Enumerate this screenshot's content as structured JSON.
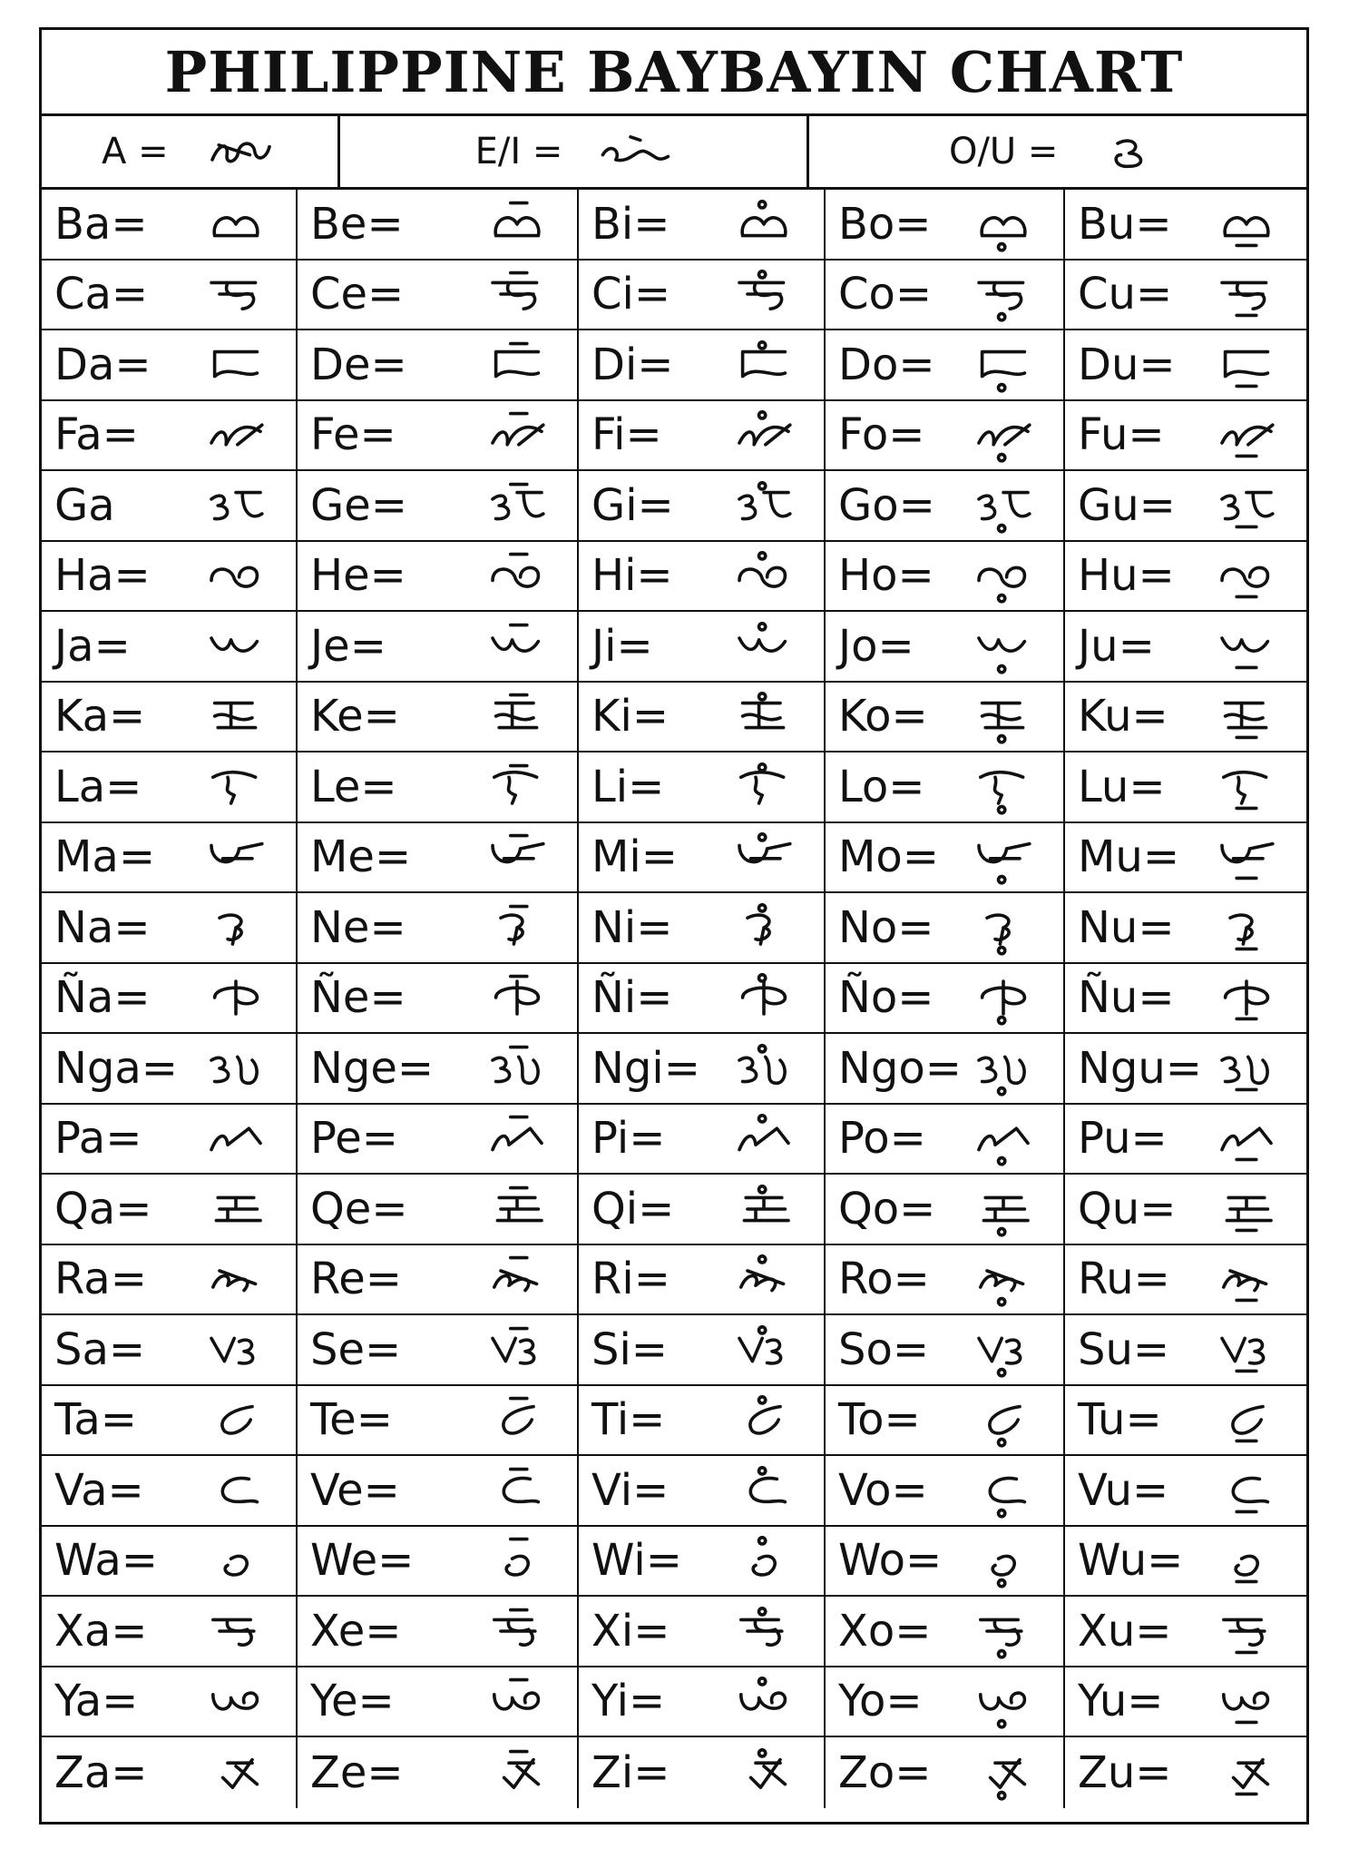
{
  "title": "PHILIPPINE BAYBAYIN CHART",
  "vowels": [
    {
      "label": "A =",
      "glyph": "a",
      "icon": "baybayin-a-icon"
    },
    {
      "label": "E/I =",
      "glyph": "ei",
      "icon": "baybayin-ei-icon"
    },
    {
      "label": "O/U =",
      "glyph": "ou",
      "icon": "baybayin-ou-icon"
    }
  ],
  "rows": [
    {
      "cells": [
        "Ba=",
        "Be=",
        "Bi=",
        "Bo=",
        "Bu="
      ]
    },
    {
      "cells": [
        "Ca=",
        "Ce=",
        "Ci=",
        "Co=",
        "Cu="
      ]
    },
    {
      "cells": [
        "Da=",
        "De=",
        "Di=",
        "Do=",
        "Du="
      ]
    },
    {
      "cells": [
        "Fa=",
        "Fe=",
        "Fi=",
        "Fo=",
        "Fu="
      ]
    },
    {
      "cells": [
        "Ga",
        "Ge=",
        "Gi=",
        "Go=",
        "Gu="
      ]
    },
    {
      "cells": [
        "Ha=",
        "He=",
        "Hi=",
        "Ho=",
        "Hu="
      ]
    },
    {
      "cells": [
        "Ja=",
        "Je=",
        "Ji=",
        "Jo=",
        "Ju="
      ]
    },
    {
      "cells": [
        "Ka=",
        "Ke=",
        "Ki=",
        "Ko=",
        "Ku="
      ]
    },
    {
      "cells": [
        "La=",
        "Le=",
        "Li=",
        "Lo=",
        "Lu="
      ]
    },
    {
      "cells": [
        "Ma=",
        "Me=",
        "Mi=",
        "Mo=",
        "Mu="
      ]
    },
    {
      "cells": [
        "Na=",
        "Ne=",
        "Ni=",
        "No=",
        "Nu="
      ]
    },
    {
      "cells": [
        "Ña=",
        "Ñe=",
        "Ñi=",
        "Ño=",
        "Ñu="
      ]
    },
    {
      "cells": [
        "Nga=",
        "Nge=",
        "Ngi=",
        "Ngo=",
        "Ngu="
      ]
    },
    {
      "cells": [
        "Pa=",
        "Pe=",
        "Pi=",
        "Po=",
        "Pu="
      ]
    },
    {
      "cells": [
        "Qa=",
        "Qe=",
        "Qi=",
        "Qo=",
        "Qu="
      ]
    },
    {
      "cells": [
        "Ra=",
        "Re=",
        "Ri=",
        "Ro=",
        "Ru="
      ]
    },
    {
      "cells": [
        "Sa=",
        "Se=",
        "Si=",
        "So=",
        "Su="
      ]
    },
    {
      "cells": [
        "Ta=",
        "Te=",
        "Ti=",
        "To=",
        "Tu="
      ]
    },
    {
      "cells": [
        "Va=",
        "Ve=",
        "Vi=",
        "Vo=",
        "Vu="
      ]
    },
    {
      "cells": [
        "Wa=",
        "We=",
        "Wi=",
        "Wo=",
        "Wu="
      ]
    },
    {
      "cells": [
        "Xa=",
        "Xe=",
        "Xi=",
        "Xo=",
        "Xu="
      ]
    },
    {
      "cells": [
        "Ya=",
        "Ye=",
        "Yi=",
        "Yo=",
        "Yu="
      ]
    },
    {
      "cells": [
        "Za=",
        "Ze=",
        "Zi=",
        "Zo=",
        "Zu="
      ]
    }
  ],
  "colors": {
    "ink": "#111111",
    "paper": "#ffffff"
  }
}
